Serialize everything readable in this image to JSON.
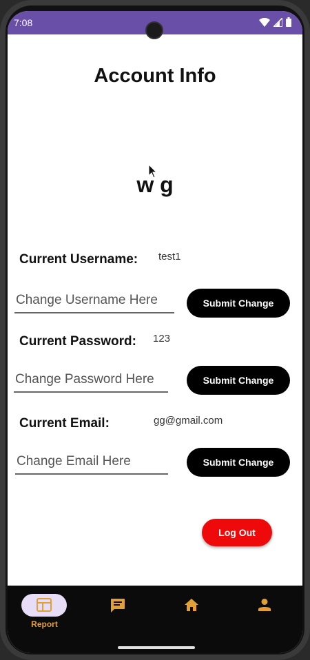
{
  "status_bar": {
    "time": "7:08"
  },
  "page": {
    "title": "Account Info",
    "display_name": "w g"
  },
  "username": {
    "label": "Current Username:",
    "value": "test1",
    "placeholder": "Change Username Here",
    "submit_label": "Submit Change"
  },
  "password": {
    "label": "Current Password:",
    "value": "123",
    "placeholder": "Change Password Here",
    "submit_label": "Submit Change"
  },
  "email": {
    "label": "Current Email:",
    "value": "gg@gmail.com",
    "placeholder": "Change Email Here",
    "submit_label": "Submit Change"
  },
  "logout_label": "Log Out",
  "nav": {
    "items": [
      {
        "label": "Report",
        "icon": "report-icon",
        "active": true
      },
      {
        "label": "",
        "icon": "chat-icon",
        "active": false
      },
      {
        "label": "",
        "icon": "home-icon",
        "active": false
      },
      {
        "label": "",
        "icon": "person-icon",
        "active": false
      }
    ]
  },
  "colors": {
    "status_bar": "#6a4fa8",
    "nav_active_pill": "#e8ddf6",
    "nav_icon": "#e0a035",
    "logout": "#ee0a0a",
    "submit": "#000000"
  }
}
